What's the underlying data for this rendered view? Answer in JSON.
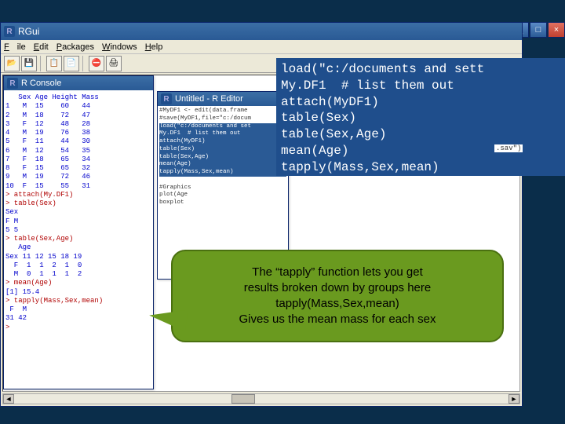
{
  "titlebar": {
    "app_title": "RGui"
  },
  "winbtns": {
    "min": "_",
    "max": "□",
    "close": "×"
  },
  "menu": {
    "file": "File",
    "edit": "Edit",
    "packages": "Packages",
    "windows": "Windows",
    "help": "Help"
  },
  "toolbar": {
    "open": "📂",
    "save": "💾",
    "copy": "📋",
    "paste": "📄",
    "stop": "⛔",
    "print": "🖨"
  },
  "console": {
    "title": "R Console",
    "header": "   Sex Age Height Mass",
    "rows": [
      "1   M  15    60   44",
      "2   M  18    72   47",
      "3   F  12    48   28",
      "4   M  19    76   38",
      "5   F  11    44   30",
      "6   M  12    54   35",
      "7   F  18    65   34",
      "8   F  15    65   32",
      "9   M  19    72   46",
      "10  F  15    55   31"
    ],
    "cmd1": "> attach(My.DF1)",
    "cmd2": "> table(Sex)",
    "out1": "Sex\nF M\n5 5",
    "cmd3": "> table(Sex,Age)",
    "out2": "   Age\nSex 11 12 15 18 19\n  F  1  1  2  1  0\n  M  0  1  1  1  2",
    "cmd4": "> mean(Age)",
    "out3": "[1] 15.4",
    "cmd5": "> tapply(Mass,Sex,mean)",
    "out4": " F  M\n31 42",
    "prompt": ">"
  },
  "editor": {
    "title": "Untitled - R Editor",
    "comment_block": "#MyDF1 <- edit(data.frame\n#save(MyDF1,file=\"c:/docum",
    "hl_block": "load(\"c:/documents and set\nMy.DF1  # list them out\nattach(MyDF1)\ntable(Sex)\ntable(Sex,Age)\nmean(Age)\ntapply(Mass,Sex,mean)",
    "graphics_block": "\n#Graphics\nplot(Age\nboxplot"
  },
  "bigcode": {
    "text": "load(\"c:/documents and sett\nMy.DF1  # list them out\nattach(MyDF1)\ntable(Sex)\ntable(Sex,Age)\nmean(Age)\ntapply(Mass,Sex,mean)"
  },
  "sav_fragment": ".sav\")",
  "callout": {
    "line1": "The “tapply” function lets you get",
    "line2": "results broken down by groups here",
    "line3": "tapply(Mass,Sex,mean)",
    "line4": "Gives us the mean mass for each sex"
  }
}
